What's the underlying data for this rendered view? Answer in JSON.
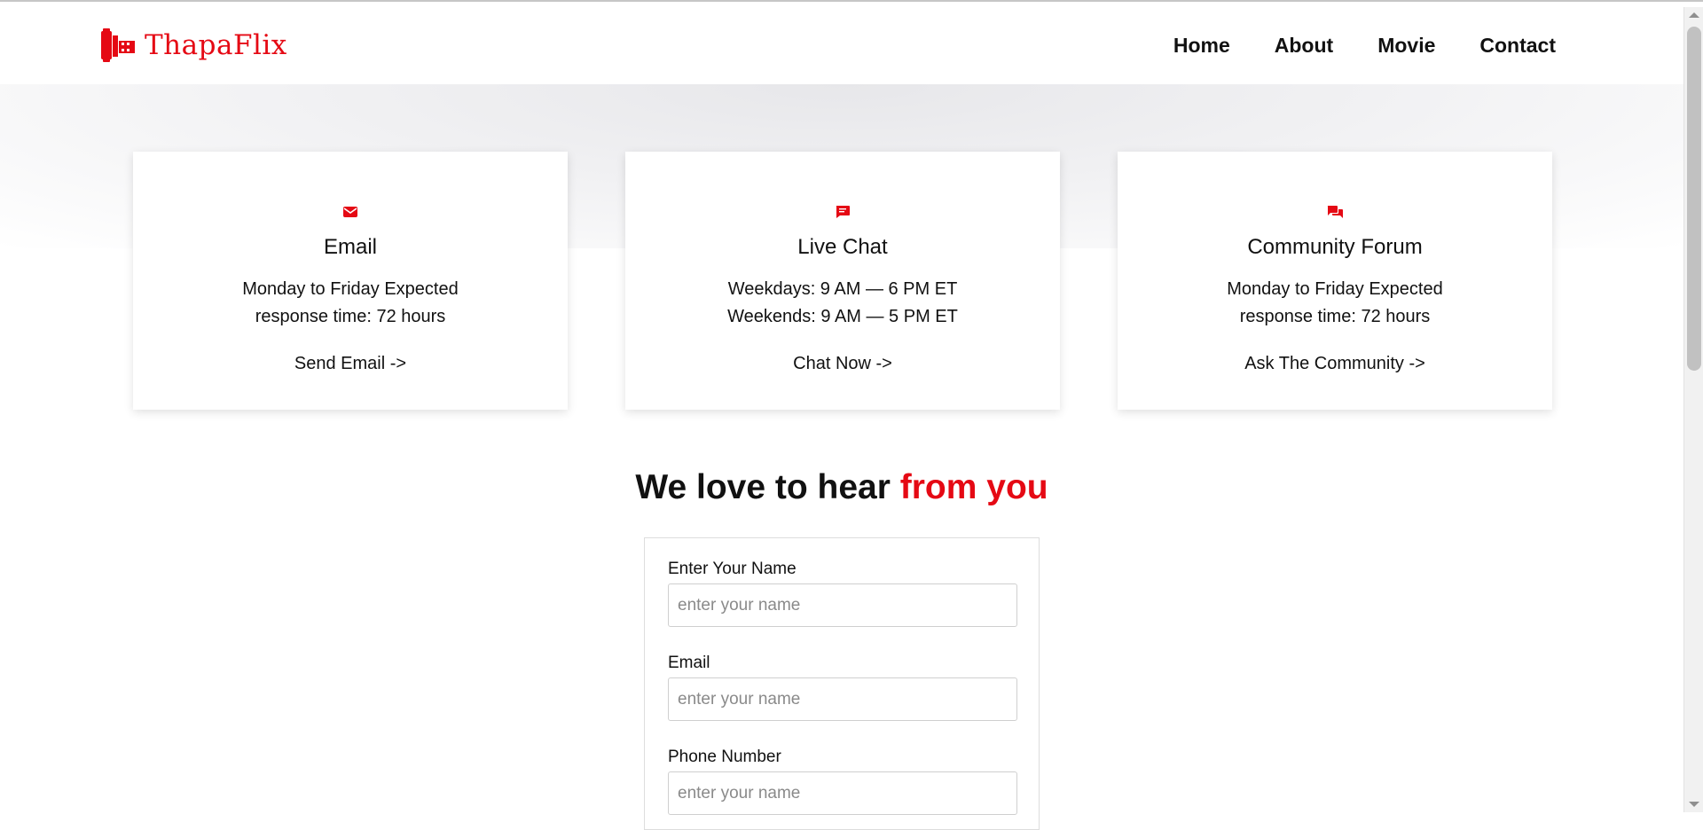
{
  "brand": {
    "name": "ThapaFlix",
    "accent_color": "#e50914",
    "logo_icon": "film-reel-icon"
  },
  "nav": {
    "items": [
      {
        "label": "Home"
      },
      {
        "label": "About"
      },
      {
        "label": "Movie"
      },
      {
        "label": "Contact"
      }
    ]
  },
  "cards": [
    {
      "icon": "email-icon",
      "title": "Email",
      "desc": "Monday to Friday Expected response time: 72 hours",
      "link": "Send Email ->"
    },
    {
      "icon": "chat-icon",
      "title": "Live Chat",
      "desc_line1": "Weekdays: 9 AM — 6 PM ET",
      "desc_line2": "Weekends: 9 AM — 5 PM ET",
      "link": "Chat Now ->"
    },
    {
      "icon": "forum-icon",
      "title": "Community Forum",
      "desc": "Monday to Friday Expected response time: 72 hours",
      "link": "Ask The Community ->"
    }
  ],
  "headline": {
    "text": "We love to hear ",
    "accent": "from you"
  },
  "form": {
    "fields": [
      {
        "label": "Enter Your Name",
        "placeholder": "enter your name"
      },
      {
        "label": "Email",
        "placeholder": "enter your name"
      },
      {
        "label": "Phone Number",
        "placeholder": "enter your name"
      }
    ]
  }
}
